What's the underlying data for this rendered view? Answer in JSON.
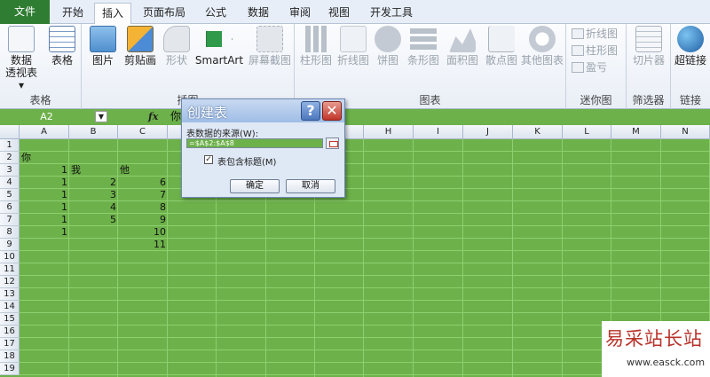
{
  "tabs": {
    "file": "文件",
    "items": [
      "开始",
      "插入",
      "页面布局",
      "公式",
      "数据",
      "审阅",
      "视图",
      "开发工具"
    ]
  },
  "ribbon": {
    "pivot": {
      "label": "数据透视表 ▾",
      "line1": "数据",
      "line2": "透视表 ▾"
    },
    "table": "表格",
    "tables_group": "表格",
    "picture": "图片",
    "clipart": "剪贴画",
    "shapes": "形状",
    "smartart": "SmartArt",
    "screenshot": "屏幕截图",
    "illustrations_group": "插图",
    "bar_chart": "柱形图",
    "line_chart": "折线图",
    "pie_chart": "饼图",
    "hbar_chart": "条形图",
    "area_chart": "面积图",
    "scatter_chart": "散点图",
    "other_charts": "其他图表",
    "charts_group": "图表",
    "spark_line": "折线图",
    "spark_column": "柱形图",
    "spark_winloss": "盈亏",
    "sparklines_group": "迷你图",
    "slicer": "切片器",
    "filter_group": "筛选器",
    "hyperlink": "超链接",
    "links_group": "链接"
  },
  "formula_bar": {
    "name_box": "A2",
    "fx": "fx",
    "value": "你"
  },
  "columns": [
    "A",
    "B",
    "C",
    "D",
    "E",
    "F",
    "G",
    "H",
    "I",
    "J",
    "K",
    "L",
    "M",
    "N"
  ],
  "rows": [
    "1",
    "2",
    "3",
    "4",
    "5",
    "6",
    "7",
    "8",
    "9",
    "10",
    "11",
    "12",
    "13",
    "14",
    "15",
    "16",
    "17",
    "18",
    "19"
  ],
  "cells": {
    "A2": "你",
    "A3": "1",
    "B3": "我",
    "C3": "他",
    "A4": "1",
    "B4": "2",
    "C4": "6",
    "A5": "1",
    "B5": "3",
    "C5": "7",
    "A6": "1",
    "B6": "4",
    "C6": "8",
    "A7": "1",
    "B7": "5",
    "C7": "9",
    "A8": "1",
    "C8": "10",
    "C9": "11"
  },
  "dialog": {
    "title": "创建表",
    "help": "?",
    "close": "✕",
    "source_label": "表数据的来源(W):",
    "range_value": "=$A$2:$A$8",
    "header_check": "✓",
    "header_label": "表包含标题(M)",
    "ok": "确定",
    "cancel": "取消"
  },
  "watermark": {
    "title": "易采站长站",
    "url": "www.easck.com"
  },
  "colors": {
    "sheet": "#6db14a",
    "file_tab": "#2f7d32"
  }
}
